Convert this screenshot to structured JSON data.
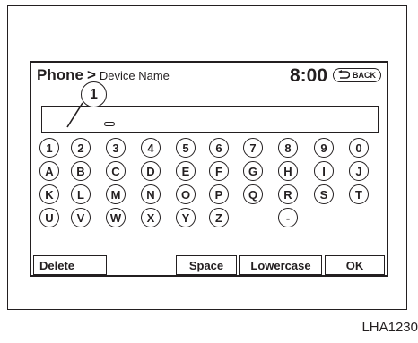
{
  "header": {
    "title": "Phone",
    "separator": ">",
    "subtitle": "Device Name",
    "clock": "8:00",
    "back_label": "BACK"
  },
  "callout": {
    "number": "1"
  },
  "keyboard": {
    "rows": [
      [
        "1",
        "2",
        "3",
        "4",
        "5",
        "6",
        "7",
        "8",
        "9",
        "0"
      ],
      [
        "A",
        "B",
        "C",
        "D",
        "E",
        "F",
        "G",
        "H",
        "I",
        "J"
      ],
      [
        "K",
        "L",
        "M",
        "N",
        "O",
        "P",
        "Q",
        "R",
        "S",
        "T"
      ],
      [
        "U",
        "V",
        "W",
        "X",
        "Y",
        "Z",
        "",
        "-"
      ]
    ]
  },
  "buttons": {
    "delete": "Delete",
    "space": "Space",
    "lowercase": "Lowercase",
    "ok": "OK"
  },
  "figure_code": "LHA1230"
}
